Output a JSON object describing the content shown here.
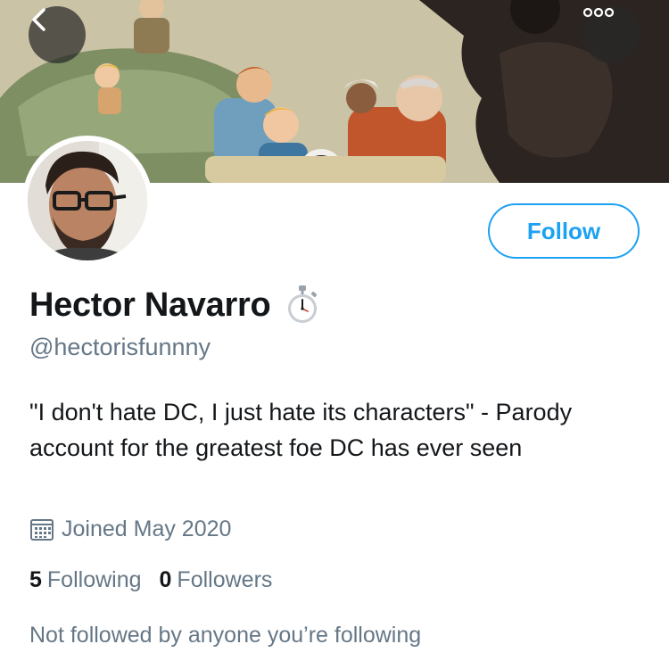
{
  "header": {
    "back_icon": "chevron-left-icon",
    "more_icon": "more-dots-icon"
  },
  "profile": {
    "display_name": "Hector Navarro",
    "name_emoji": "stopwatch-icon",
    "handle": "@hectorisfunnny",
    "bio": "\"I don't hate DC, I just hate its characters\" - Parody account for the greatest foe DC has ever seen",
    "joined": "Joined May 2020",
    "follow_label": "Follow"
  },
  "stats": {
    "following_count": "5",
    "following_label": "Following",
    "followers_count": "0",
    "followers_label": "Followers"
  },
  "social_context": "Not followed by anyone you’re following",
  "colors": {
    "accent": "#1da1f2",
    "secondary_text": "#657786",
    "primary_text": "#14171a"
  }
}
